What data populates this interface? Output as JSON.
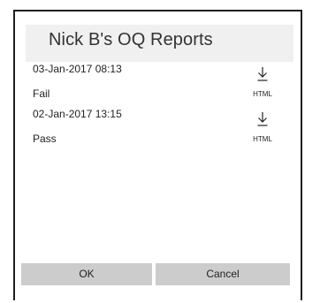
{
  "dialog": {
    "title": "Nick B's OQ Reports"
  },
  "reports": [
    {
      "date": "03-Jan-2017 08:13",
      "status": "Fail",
      "download_label": "HTML",
      "icon": "download-icon"
    },
    {
      "date": "02-Jan-2017 13:15",
      "status": "Pass",
      "download_label": "HTML",
      "icon": "download-icon"
    }
  ],
  "buttons": {
    "ok_label": "OK",
    "cancel_label": "Cancel"
  }
}
